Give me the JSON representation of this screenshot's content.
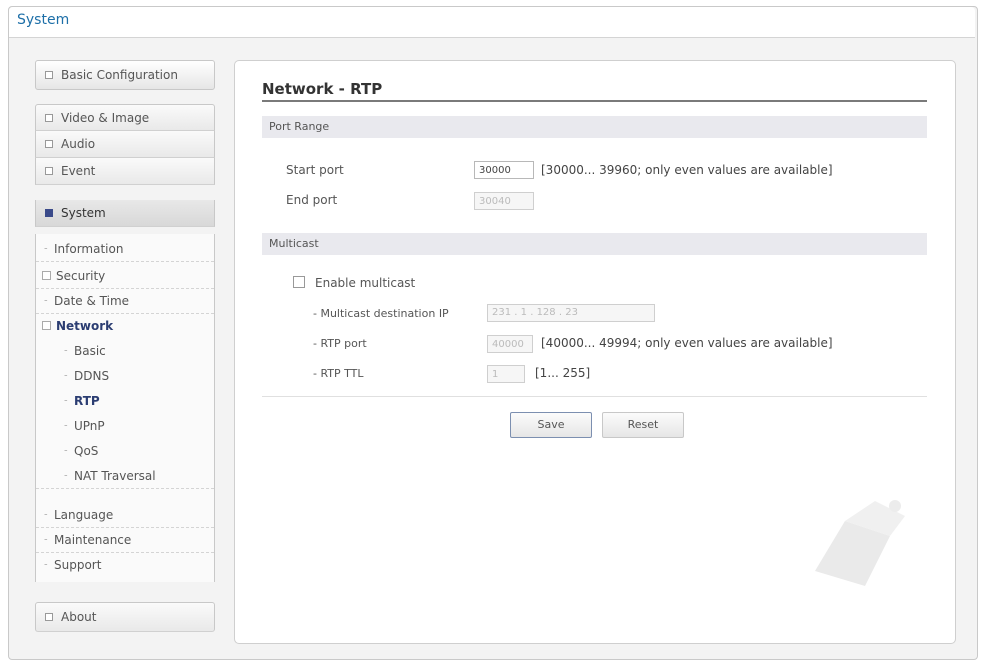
{
  "window": {
    "title": "System"
  },
  "sidebar": {
    "basic_configuration": "Basic Configuration",
    "top_items": [
      {
        "label": "Video & Image"
      },
      {
        "label": "Audio"
      },
      {
        "label": "Event"
      },
      {
        "label": "System"
      }
    ],
    "system_items": [
      {
        "label": "Information"
      },
      {
        "label": "Security"
      },
      {
        "label": "Date & Time"
      },
      {
        "label": "Network"
      }
    ],
    "network_items": [
      {
        "label": "Basic"
      },
      {
        "label": "DDNS"
      },
      {
        "label": "RTP"
      },
      {
        "label": "UPnP"
      },
      {
        "label": "QoS"
      },
      {
        "label": "NAT Traversal"
      }
    ],
    "more_items": [
      {
        "label": "Language"
      },
      {
        "label": "Maintenance"
      },
      {
        "label": "Support"
      }
    ],
    "about": "About"
  },
  "main": {
    "title": "Network - RTP",
    "port_range": {
      "heading": "Port Range",
      "start_label": "Start port",
      "start_value": "30000",
      "start_hint": "[30000... 39960; only even values are available]",
      "end_label": "End port",
      "end_value": "30040"
    },
    "multicast": {
      "heading": "Multicast",
      "enable_label": "Enable multicast",
      "dest_ip_label": "- Multicast destination IP",
      "dest_ip": [
        "231",
        "1",
        "128",
        "23"
      ],
      "rtp_port_label": "- RTP port",
      "rtp_port_value": "40000",
      "rtp_port_hint": "[40000... 49994; only even values are available]",
      "rtp_ttl_label": "- RTP TTL",
      "rtp_ttl_value": "1",
      "rtp_ttl_hint": "[1... 255]"
    },
    "buttons": {
      "save": "Save",
      "reset": "Reset"
    }
  },
  "icons": {
    "collapsed": "square-icon",
    "expanded": "filled-square-icon",
    "tree_expand": "plus-box-icon",
    "tree_collapse": "minus-box-icon",
    "bullet": "dash-bullet-icon"
  }
}
